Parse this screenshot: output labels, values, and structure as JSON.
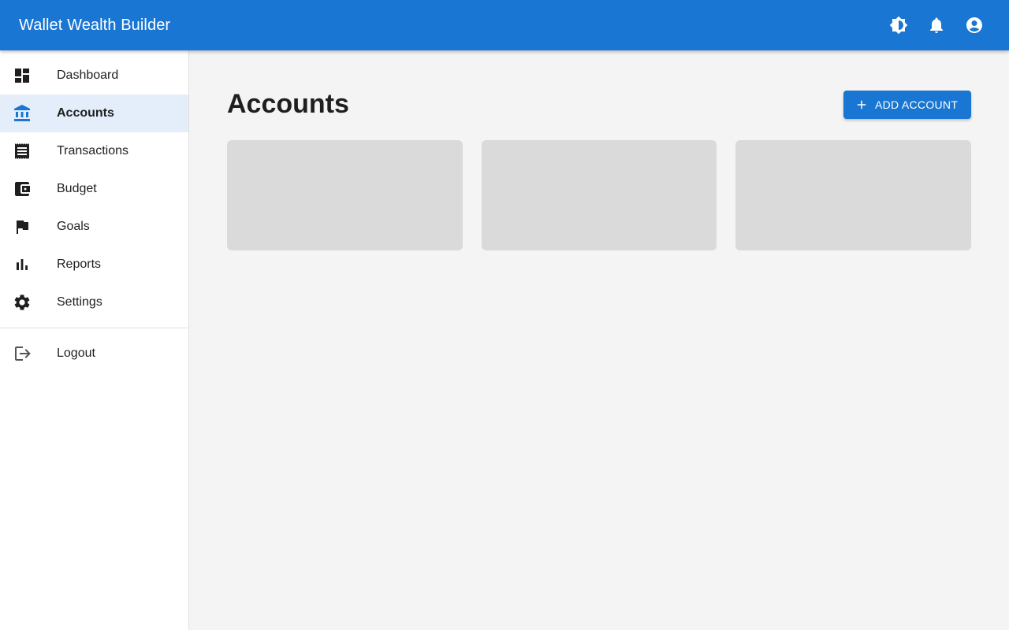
{
  "app": {
    "title": "Wallet Wealth Builder"
  },
  "appbar": {
    "actions": [
      {
        "name": "theme-toggle-icon"
      },
      {
        "name": "bell-icon"
      },
      {
        "name": "account-circle-icon"
      }
    ]
  },
  "sidebar": {
    "items": [
      {
        "label": "Dashboard",
        "icon": "dashboard-icon"
      },
      {
        "label": "Accounts",
        "icon": "bank-icon",
        "active": true
      },
      {
        "label": "Transactions",
        "icon": "receipt-icon"
      },
      {
        "label": "Budget",
        "icon": "wallet-icon"
      },
      {
        "label": "Goals",
        "icon": "flag-icon"
      },
      {
        "label": "Reports",
        "icon": "bar-chart-icon"
      },
      {
        "label": "Settings",
        "icon": "gear-icon"
      }
    ],
    "logout": {
      "label": "Logout",
      "icon": "logout-icon"
    }
  },
  "main": {
    "title": "Accounts",
    "add_button": {
      "label": "ADD ACCOUNT",
      "icon": "plus-icon"
    },
    "cards": [
      {
        "state": "loading"
      },
      {
        "state": "loading"
      },
      {
        "state": "loading"
      }
    ]
  },
  "colors": {
    "primary": "#1976d2",
    "active_bg": "#e3eefa",
    "skeleton": "#dadada",
    "background": "#f4f4f4"
  }
}
